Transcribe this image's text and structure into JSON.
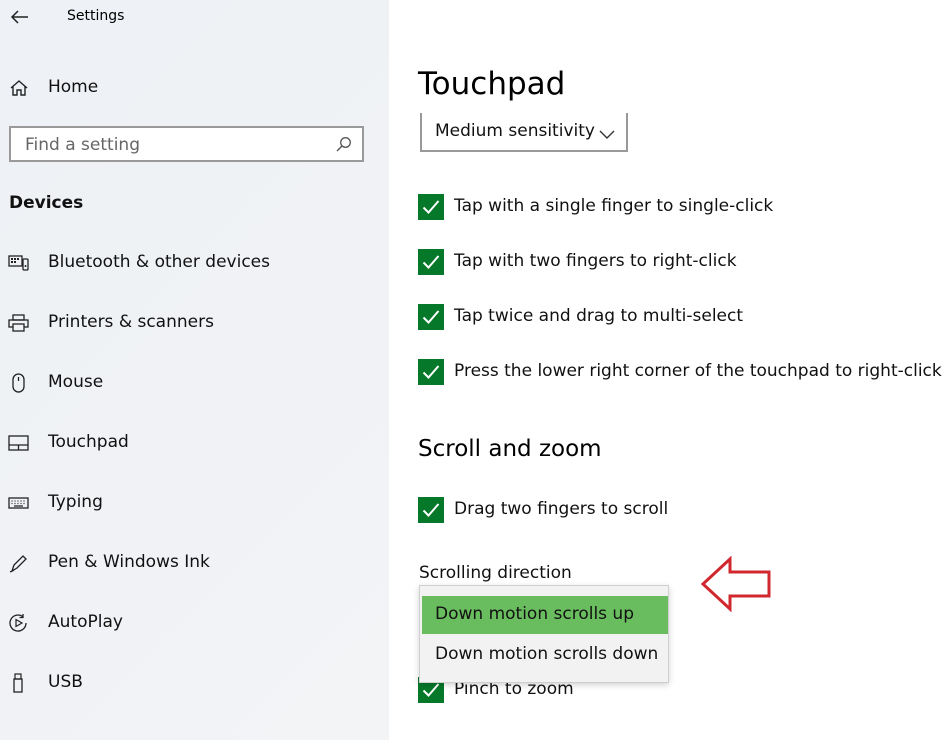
{
  "window": {
    "title": "Settings"
  },
  "sidebar": {
    "home_label": "Home",
    "search": {
      "placeholder": "Find a setting"
    },
    "section_heading": "Devices",
    "items": [
      {
        "label": "Bluetooth & other devices",
        "icon": "bluetooth-devices-icon"
      },
      {
        "label": "Printers & scanners",
        "icon": "printer-icon"
      },
      {
        "label": "Mouse",
        "icon": "mouse-icon"
      },
      {
        "label": "Touchpad",
        "icon": "touchpad-icon"
      },
      {
        "label": "Typing",
        "icon": "keyboard-icon"
      },
      {
        "label": "Pen & Windows Ink",
        "icon": "pen-icon"
      },
      {
        "label": "AutoPlay",
        "icon": "autoplay-icon"
      },
      {
        "label": "USB",
        "icon": "usb-icon"
      }
    ]
  },
  "main": {
    "title": "Touchpad",
    "sensitivity": {
      "value": "Medium sensitivity"
    },
    "tap_options": [
      {
        "label": "Tap with a single finger to single-click",
        "checked": true
      },
      {
        "label": "Tap with two fingers to right-click",
        "checked": true
      },
      {
        "label": "Tap twice and drag to multi-select",
        "checked": true
      },
      {
        "label": "Press the lower right corner of the touchpad to right-click",
        "checked": true
      }
    ],
    "scroll_zoom": {
      "heading": "Scroll and zoom",
      "drag_scroll": {
        "label": "Drag two fingers to scroll",
        "checked": true
      },
      "direction_label": "Scrolling direction",
      "direction_options": [
        {
          "label": "Down motion scrolls up",
          "selected": true
        },
        {
          "label": "Down motion scrolls down",
          "selected": false
        }
      ],
      "pinch_zoom": {
        "label": "Pinch to zoom",
        "checked": true
      }
    }
  },
  "colors": {
    "checkbox": "#067829",
    "selected_option": "#69bd5f",
    "annotation_arrow": "#d0282e"
  }
}
